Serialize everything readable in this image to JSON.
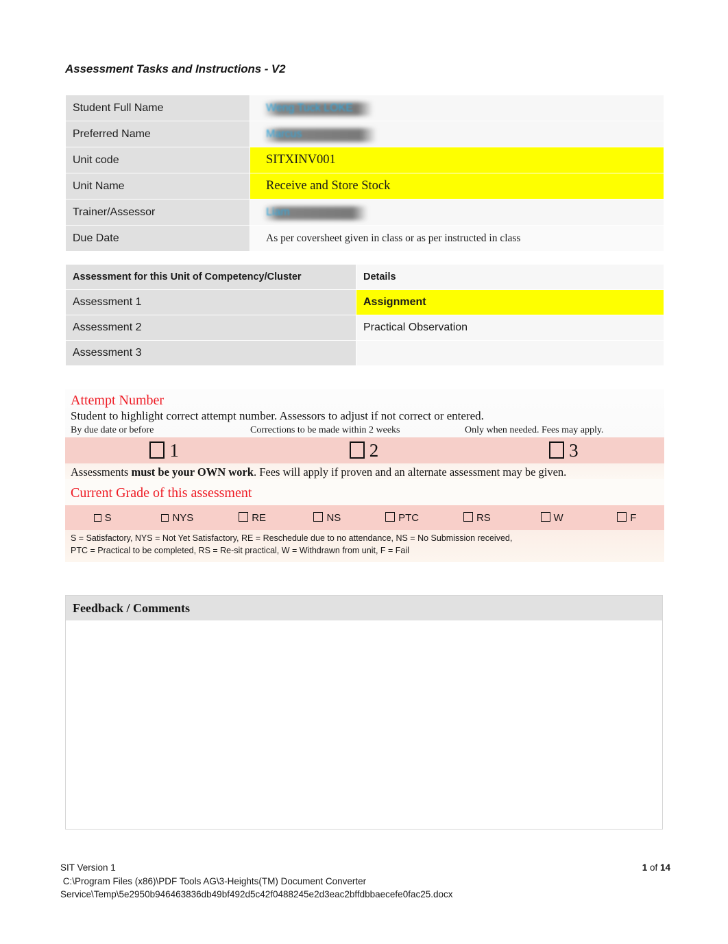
{
  "document": {
    "title": "Assessment Tasks and Instructions - V2"
  },
  "info": {
    "rows": [
      {
        "label": "Student Full Name",
        "value": "Weng Tuck LOKE",
        "style": "redacted"
      },
      {
        "label": "Preferred Name",
        "value": "Marcus",
        "style": "redacted"
      },
      {
        "label": "Unit code",
        "value": "SITXINV001",
        "style": "highlight-yellow"
      },
      {
        "label": "Unit Name",
        "value": "Receive and Store Stock",
        "style": "highlight-yellow"
      },
      {
        "label": "Trainer/Assessor",
        "value": "Liam",
        "style": "redacted"
      },
      {
        "label": "Due Date",
        "value": "As per coversheet given in class or as per instructed in class",
        "style": "plain"
      }
    ]
  },
  "assessment_table": {
    "headers": [
      "Assessment for this Unit of Competency/Cluster",
      "Details"
    ],
    "rows": [
      {
        "name": "Assessment 1",
        "detail": "Assignment",
        "style": "highlight-yellow"
      },
      {
        "name": "Assessment 2",
        "detail": "Practical Observation",
        "style": "plain"
      },
      {
        "name": "Assessment 3",
        "detail": "",
        "style": "plain"
      }
    ]
  },
  "attempt": {
    "heading": "Attempt Number",
    "instruction": "Student to highlight correct attempt number. Assessors to adjust if not correct or entered.",
    "hints": [
      "By due date or before",
      "Corrections to be made within 2 weeks",
      "Only when needed. Fees may apply."
    ],
    "options": [
      "1",
      "2",
      "3"
    ],
    "own_work_prefix": "Assessments ",
    "own_work_bold": "must be your OWN work",
    "own_work_suffix": ". Fees will apply if proven and an alternate assessment may be given."
  },
  "grade": {
    "heading": "Current Grade of this assessment",
    "options": [
      {
        "code": "S",
        "size": "sm"
      },
      {
        "code": "NYS",
        "size": "sm"
      },
      {
        "code": "RE",
        "size": "md"
      },
      {
        "code": "NS",
        "size": "md"
      },
      {
        "code": "PTC",
        "size": "md"
      },
      {
        "code": "RS",
        "size": "md"
      },
      {
        "code": "W",
        "size": "md"
      },
      {
        "code": "F",
        "size": "md"
      }
    ],
    "legend_line1": "S = Satisfactory, NYS = Not Yet Satisfactory, RE = Reschedule due to no attendance, NS = No Submission received,",
    "legend_line2": " PTC = Practical to be completed, RS = Re-sit practical, W = Withdrawn from unit, F = Fail"
  },
  "feedback": {
    "heading": "Feedback / Comments",
    "content": ""
  },
  "footer": {
    "version": "SIT Version 1",
    "page_prefix": "",
    "page_current": "1",
    "page_of": " of ",
    "page_total": "14",
    "path_line1": " C:\\Program Files (x86)\\PDF Tools AG\\3-Heights(TM) Document Converter",
    "path_line2": "Service\\Temp\\5e2950b946463836db49bf492d5c42f0488245e2d3eac2bffdbbaecefe0fac25.docx"
  },
  "colors": {
    "highlight_yellow": "#feff00",
    "redact_blue": "#31a7dd",
    "heading_red": "#ee1c25",
    "label_gray": "#e0e0e0",
    "pink_strip": "#f6cfc9"
  }
}
